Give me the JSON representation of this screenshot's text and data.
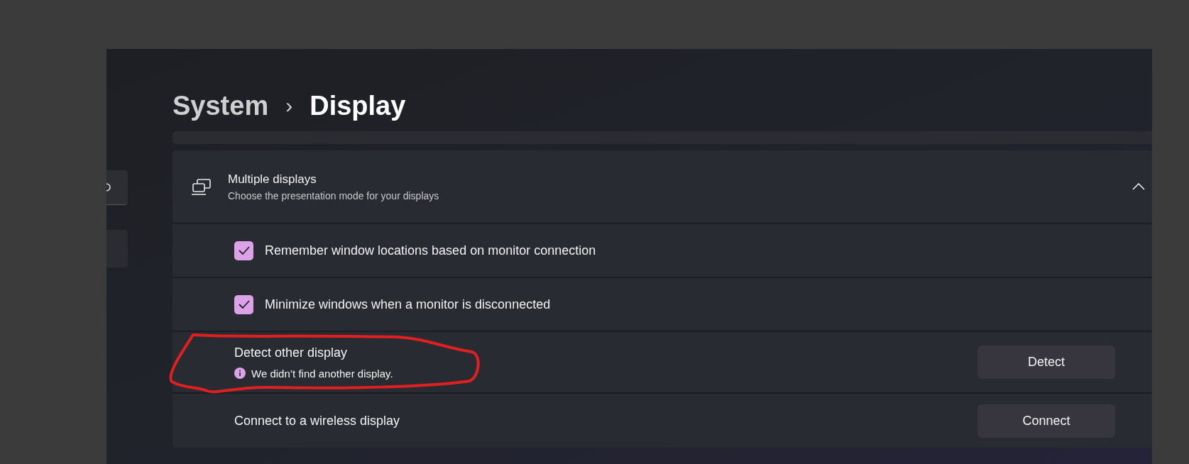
{
  "breadcrumb": {
    "parent": "System",
    "separator": "›",
    "current": "Display"
  },
  "section": {
    "title": "Multiple displays",
    "subtitle": "Choose the presentation mode for your displays",
    "expanded": true,
    "rows": [
      {
        "kind": "checkbox",
        "label": "Remember window locations based on monitor connection",
        "checked": true
      },
      {
        "kind": "checkbox",
        "label": "Minimize windows when a monitor is disconnected",
        "checked": true
      },
      {
        "kind": "button",
        "label": "Detect other display",
        "message": "We didn’t find another display.",
        "button": "Detect",
        "annotated": true
      },
      {
        "kind": "button",
        "label": "Connect to a wireless display",
        "button": "Connect",
        "annotated": false
      }
    ]
  }
}
